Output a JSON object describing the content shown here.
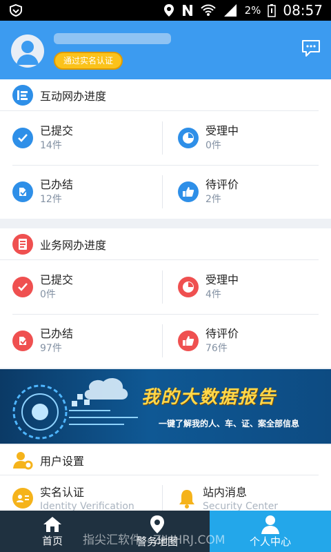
{
  "statusbar": {
    "battery": "2%",
    "time": "08:57"
  },
  "profile": {
    "badge": "通过实名认证"
  },
  "interactive": {
    "title": "互动网办进度",
    "items": [
      {
        "label": "已提交",
        "count": "14件",
        "icon": "check-icon"
      },
      {
        "label": "受理中",
        "count": "0件",
        "icon": "progress-pie-icon"
      },
      {
        "label": "已办结",
        "count": "12件",
        "icon": "finished-icon"
      },
      {
        "label": "待评价",
        "count": "2件",
        "icon": "thumbs-up-icon"
      }
    ]
  },
  "business": {
    "title": "业务网办进度",
    "items": [
      {
        "label": "已提交",
        "count": "0件",
        "icon": "check-icon"
      },
      {
        "label": "受理中",
        "count": "4件",
        "icon": "progress-pie-icon"
      },
      {
        "label": "已办结",
        "count": "97件",
        "icon": "finished-icon"
      },
      {
        "label": "待评价",
        "count": "76件",
        "icon": "thumbs-up-icon"
      }
    ]
  },
  "banner": {
    "title": "我的大数据报告",
    "subtitle": "一键了解我的人、车、证、案全部信息"
  },
  "settings": {
    "title": "用户设置",
    "items": [
      {
        "label": "实名认证",
        "sub": "Identity Verification"
      },
      {
        "label": "站内消息",
        "sub": "Security Center"
      }
    ]
  },
  "tabs": [
    {
      "label": "首页",
      "icon": "home-icon"
    },
    {
      "label": "警务地图",
      "icon": "map-pin-icon"
    },
    {
      "label": "个人中心",
      "icon": "user-icon"
    }
  ],
  "watermark": "指尖汇软件：ZJHHRJ.COM",
  "colors": {
    "primary": "#3c9bf0",
    "interactiveAccent": "#2e8fe8",
    "businessAccent": "#ef5050",
    "tabActive": "#23a7ea",
    "tabbar": "#1f3140",
    "badge": "#fbc21b"
  }
}
